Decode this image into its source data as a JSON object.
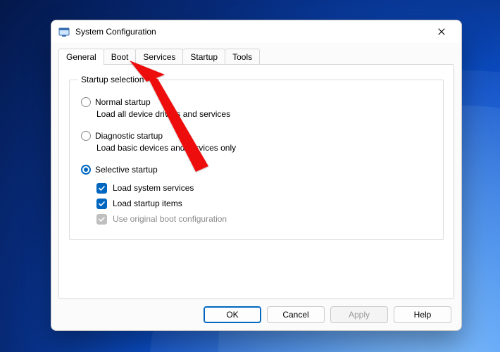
{
  "window": {
    "title": "System Configuration"
  },
  "tabs": {
    "general": "General",
    "boot": "Boot",
    "services": "Services",
    "startup": "Startup",
    "tools": "Tools",
    "active": "General"
  },
  "group": {
    "legend": "Startup selection"
  },
  "options": {
    "normal": {
      "label": "Normal startup",
      "desc": "Load all device drivers and services",
      "selected": false
    },
    "diagnostic": {
      "label": "Diagnostic startup",
      "desc": "Load basic devices and services only",
      "selected": false
    },
    "selective": {
      "label": "Selective startup",
      "selected": true,
      "load_system_services": {
        "label": "Load system services",
        "checked": true,
        "enabled": true
      },
      "load_startup_items": {
        "label": "Load startup items",
        "checked": true,
        "enabled": true
      },
      "use_original_boot": {
        "label": "Use original boot configuration",
        "checked": true,
        "enabled": false
      }
    }
  },
  "buttons": {
    "ok": "OK",
    "cancel": "Cancel",
    "apply": "Apply",
    "help": "Help"
  },
  "annotation": {
    "arrow_target": "boot-tab"
  }
}
